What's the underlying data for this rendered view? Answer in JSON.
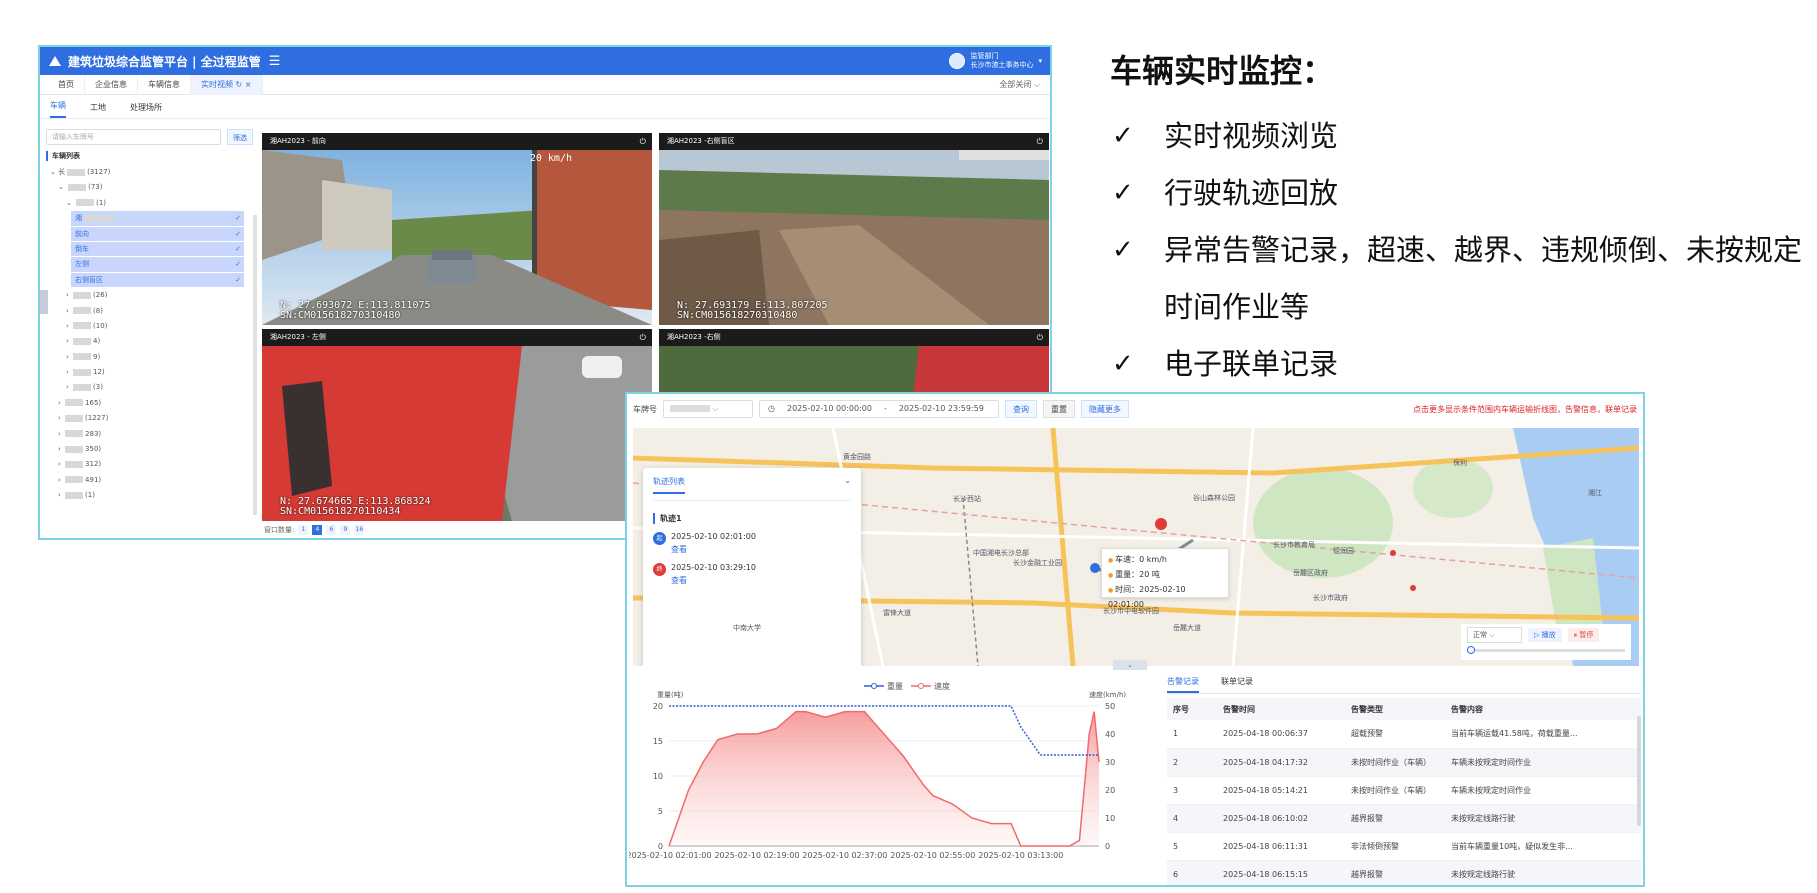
{
  "s1": {
    "app_title": "建筑垃圾综合监管平台 | 全过程监管",
    "user": {
      "role": "监管部门",
      "org": "长沙市渣土事务中心"
    },
    "tabs": [
      {
        "label": "首页"
      },
      {
        "label": "企业信息"
      },
      {
        "label": "车辆信息"
      },
      {
        "label": "实时视频"
      }
    ],
    "close_all": "全部关闭",
    "subtabs": [
      "车辆",
      "工地",
      "处理场所"
    ],
    "search_placeholder": "请输入车牌号",
    "filter_btn": "筛选",
    "list_title": "车辆列表",
    "tree": [
      {
        "prefix": "长",
        "count": "(3127)"
      },
      {
        "prefix": "",
        "count": "(73)"
      },
      {
        "prefix": "",
        "count": "(1)"
      }
    ],
    "selected": [
      "湘",
      "前向",
      "倒车",
      "左侧",
      "右侧盲区"
    ],
    "tree_rest": [
      "(26)",
      "(8)",
      "(10)",
      "4)",
      "9)",
      "12)",
      "(3)",
      "165)",
      "(1227)",
      "283)",
      "350)",
      "312)",
      "491)",
      "(1)"
    ],
    "videos": [
      {
        "title": "湘AH2023 - 前向",
        "osd1": "N: 27.693072 E:113.811075",
        "osd2": "SN:CM015618270310480",
        "speed": "20 km/h"
      },
      {
        "title": "湘AH2023 -右侧盲区",
        "osd1": "N: 27.693179 E:113.807205",
        "osd2": "SN:CM015618270310480",
        "speed": ""
      },
      {
        "title": "湘AH2023 - 左侧",
        "osd1": "N: 27.674665 E:113.868324",
        "osd2": "SN:CM015618270110434",
        "speed": ""
      },
      {
        "title": "湘AH2023 -右侧",
        "osd1": "",
        "osd2": "",
        "speed": ""
      }
    ],
    "window_count_label": "窗口数量:",
    "window_counts": [
      "1",
      "4",
      "6",
      "9",
      "16"
    ]
  },
  "features": {
    "title": "车辆实时监控：",
    "items": [
      "实时视频浏览",
      "行驶轨迹回放",
      "异常告警记录，超速、越界、违规倾倒、未按规定时间作业等",
      "电子联单记录"
    ]
  },
  "s2": {
    "plate_label": "车牌号",
    "date_start": "2025-02-10 00:00:00",
    "date_sep": "-",
    "date_end": "2025-02-10 23:59:59",
    "btn_query": "查询",
    "btn_reset": "重置",
    "btn_hide": "隐藏更多",
    "note": "点击更多显示条件范围内车辆运输折线图，告警信息，联单记录",
    "track_list_title": "轨迹列表",
    "track_name": "轨迹1",
    "track_points": [
      {
        "marker": "起",
        "time": "2025-02-10 02:01:00",
        "link": "查看",
        "color": "#2f6ee0"
      },
      {
        "marker": "终",
        "time": "2025-02-10 03:29:10",
        "link": "查看",
        "color": "#e03a3a"
      }
    ],
    "tooltip": {
      "speed": "车速：0 km/h",
      "weight": "重量：20 吨",
      "time": "时间：2025-02-10 02:01:00"
    },
    "map_labels": [
      "黄金园路",
      "长沙西站",
      "中国湘电长沙总部",
      "长沙金融工业园",
      "长沙市教育局",
      "岳麓区政府",
      "长沙市中电软件园",
      "德润园",
      "湘江",
      "谷山森林公园",
      "长沙市政府",
      "保利",
      "中南大学",
      "岳麓大道",
      "雷锋大道"
    ],
    "play_mode": "正常",
    "btn_play": "播放",
    "btn_pause": "暂停",
    "alarm_tabs": [
      "告警记录",
      "联单记录"
    ],
    "alarm_headers": [
      "序号",
      "告警时间",
      "告警类型",
      "告警内容"
    ],
    "alarms": [
      {
        "no": "1",
        "time": "2025-04-18 00:06:37",
        "type": "超载预警",
        "content": "当前车辆运载41.58吨，荷载重量..."
      },
      {
        "no": "2",
        "time": "2025-04-18 04:17:32",
        "type": "未按时间作业（车辆）",
        "content": "车辆未按规定时间作业"
      },
      {
        "no": "3",
        "time": "2025-04-18 05:14:21",
        "type": "未按时间作业（车辆）",
        "content": "车辆未按规定时间作业"
      },
      {
        "no": "4",
        "time": "2025-04-18 06:10:02",
        "type": "越界报警",
        "content": "未按规定线路行驶"
      },
      {
        "no": "5",
        "time": "2025-04-18 06:11:31",
        "type": "非法倾倒预警",
        "content": "当前车辆重量10吨，疑似发生非..."
      },
      {
        "no": "6",
        "time": "2025-04-18 06:15:15",
        "type": "越界报警",
        "content": "未按规定线路行驶"
      }
    ]
  },
  "chart_data": {
    "type": "line",
    "legend": [
      "重量",
      "速度"
    ],
    "legend_position": "top-center",
    "ylabel_left": "重量(吨)",
    "ylabel_right": "速度(km/h)",
    "ylim_left": [
      0,
      20
    ],
    "ylim_right": [
      0,
      50
    ],
    "yticks_left": [
      0,
      5,
      10,
      15,
      20
    ],
    "yticks_right": [
      0,
      10,
      20,
      30,
      40,
      50
    ],
    "xticks": [
      "2025-02-10 02:01:00",
      "2025-02-10 02:19:00",
      "2025-02-10 02:37:00",
      "2025-02-10 02:55:00",
      "2025-02-10 03:13:00"
    ],
    "x_minutes": [
      0,
      4,
      7,
      10,
      14,
      18,
      22,
      26,
      28,
      32,
      36,
      40,
      44,
      48,
      52,
      54,
      58,
      62,
      66,
      70,
      72,
      76,
      80,
      82,
      84,
      86,
      87,
      88
    ],
    "series": [
      {
        "name": "重量",
        "axis": "left",
        "color": "#2f5fd8",
        "values": [
          20,
          20,
          20,
          20,
          20,
          20,
          20,
          20,
          20,
          20,
          20,
          20,
          20,
          20,
          20,
          20,
          20,
          20,
          20,
          20,
          17,
          13,
          13,
          13,
          13,
          13,
          13,
          13
        ]
      },
      {
        "name": "速度",
        "axis": "right",
        "color": "#f06a6a",
        "values": [
          0,
          20,
          30,
          38,
          40,
          40,
          42,
          48,
          48,
          46,
          48,
          48,
          40,
          32,
          22,
          18,
          15,
          10,
          8,
          8,
          0,
          0,
          0,
          0,
          2,
          40,
          48,
          30
        ]
      }
    ]
  }
}
